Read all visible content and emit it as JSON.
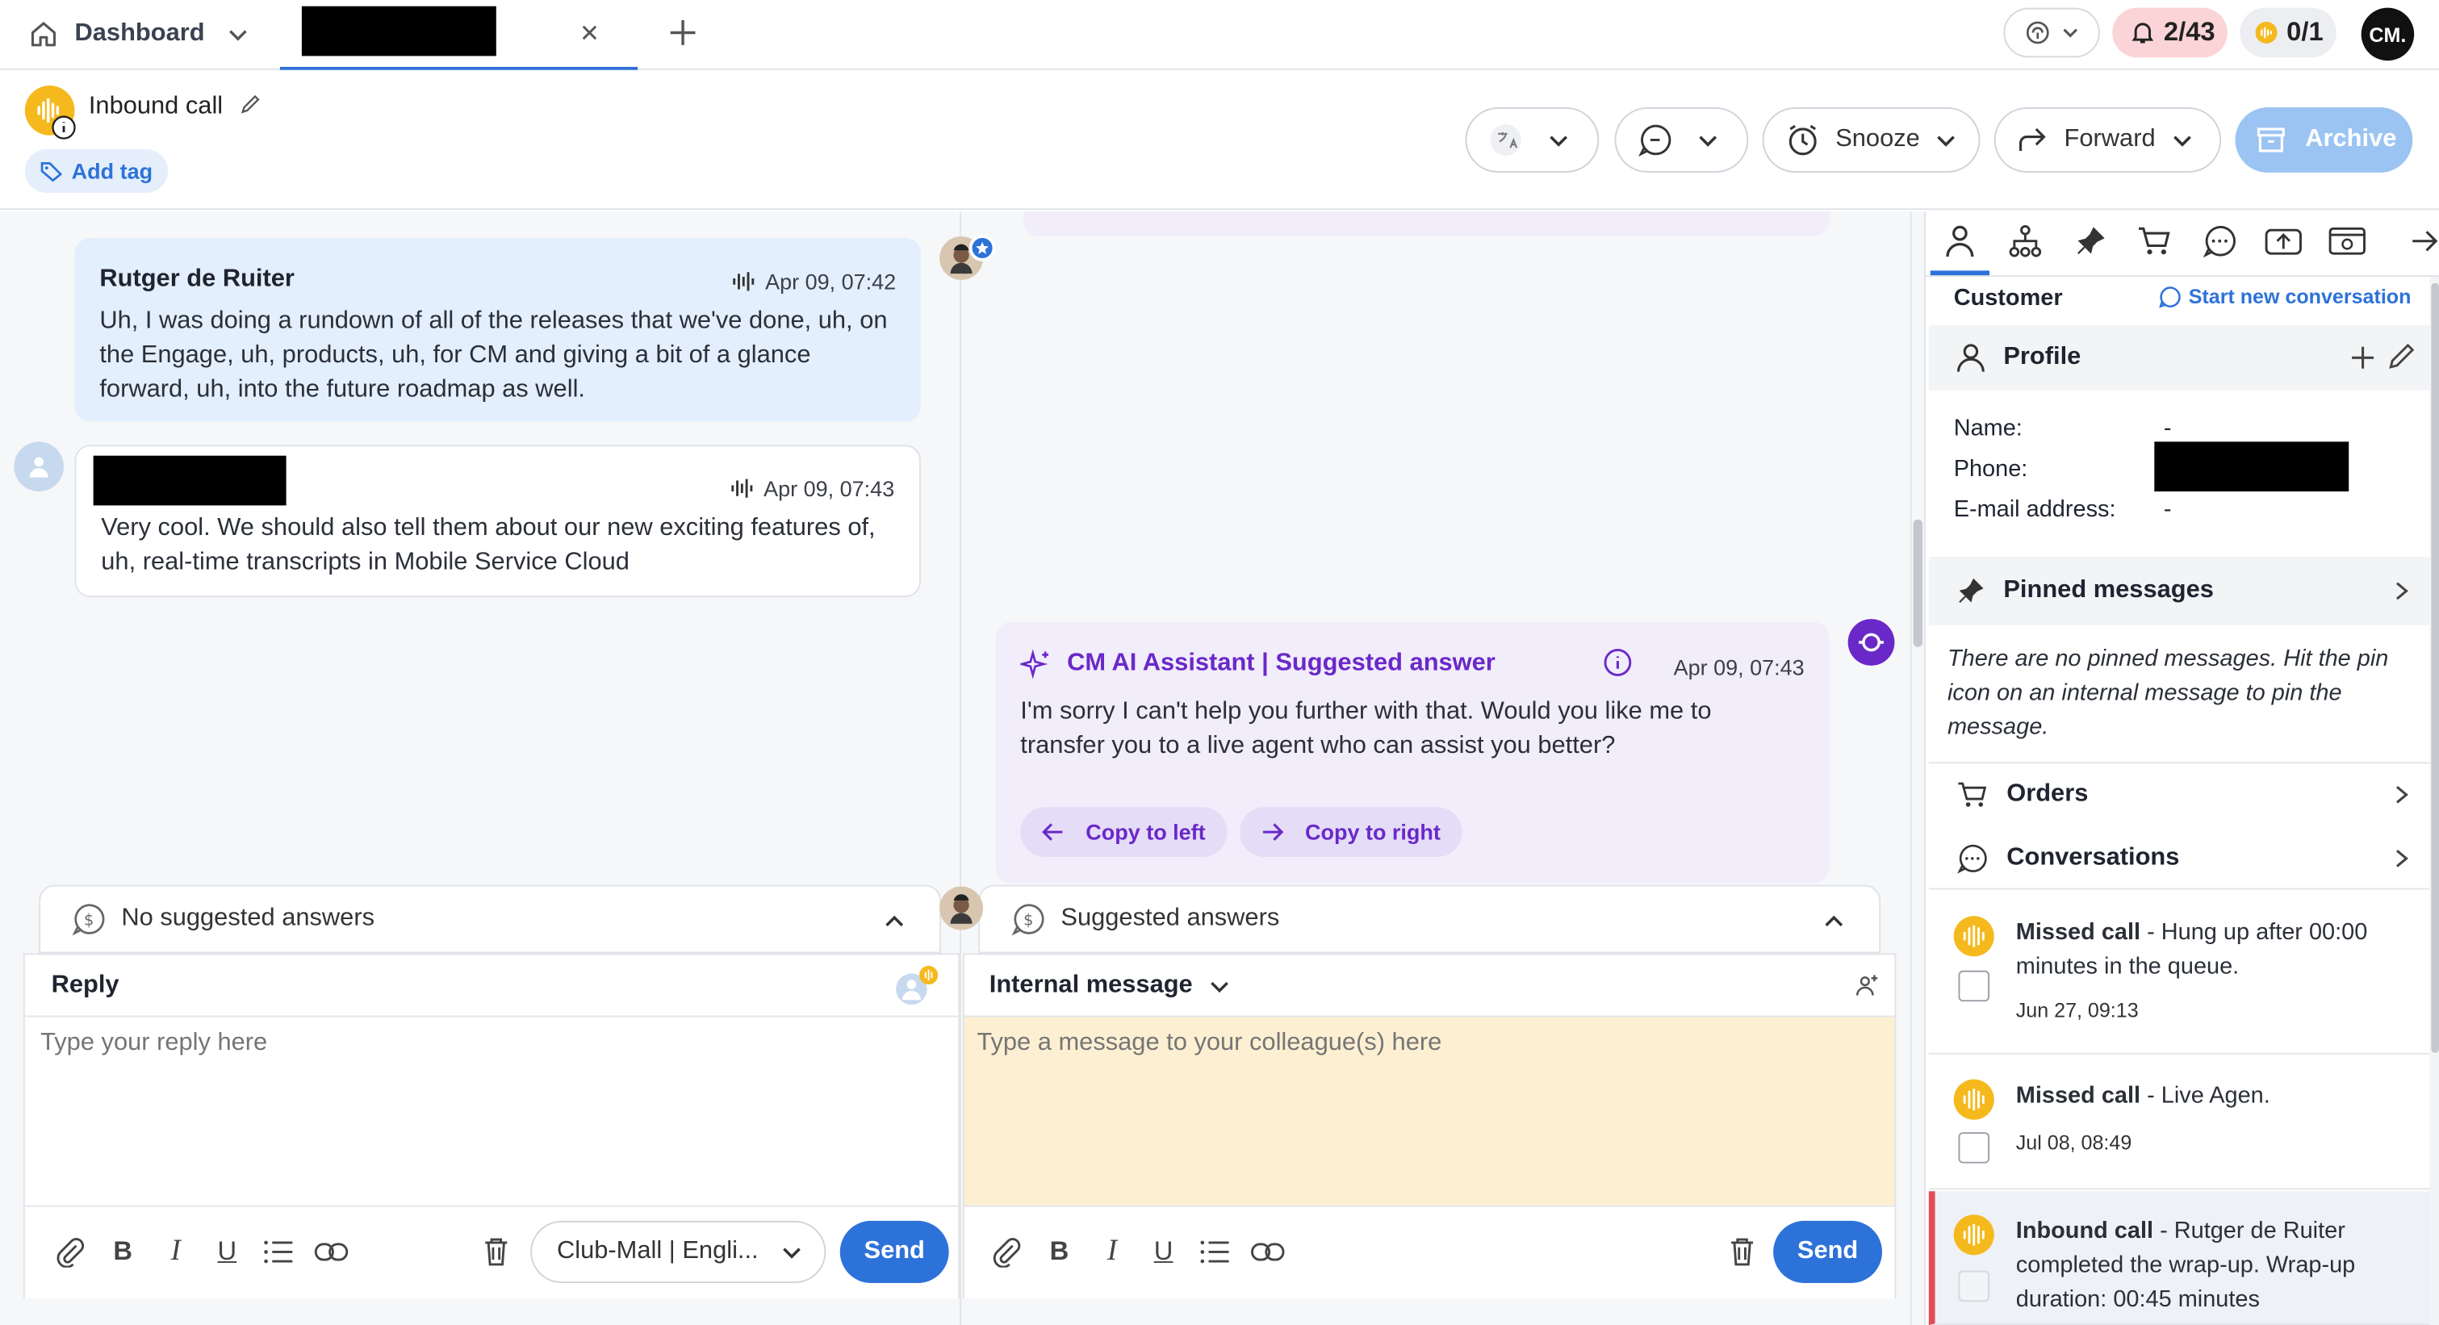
{
  "topbar": {
    "dashboard_label": "Dashboard",
    "notifications_count": "2/43",
    "calls_count": "0/1",
    "avatar_initials": "CM."
  },
  "conversation": {
    "title": "Inbound call",
    "add_tag_label": "Add tag",
    "snooze_label": "Snooze",
    "forward_label": "Forward",
    "archive_label": "Archive"
  },
  "messages": [
    {
      "author": "Rutger de Ruiter",
      "time": "Apr 09, 07:42",
      "text": "Uh, I was doing a rundown of all of the releases that we've done, uh, on the Engage, uh, products, uh, for CM and giving a bit of a glance forward, uh, into the future roadmap as well."
    },
    {
      "author": "",
      "time": "Apr 09, 07:43",
      "text": "Very cool. We should also tell them about our new exciting features of, uh, real-time transcripts in Mobile Service Cloud"
    }
  ],
  "ai_suggestion": {
    "title": "CM AI Assistant | Suggested answer",
    "time": "Apr 09, 07:43",
    "text": "I'm sorry I can't help you further with that. Would you like me to transfer you to a live agent who can assist you better?",
    "copy_left_label": "Copy to left",
    "copy_right_label": "Copy to right"
  },
  "reply": {
    "suggestions_label": "No suggested answers",
    "header_label": "Reply",
    "placeholder": "Type your reply here",
    "channel_select": "Club-Mall | Engli...",
    "send_label": "Send"
  },
  "internal": {
    "suggestions_label": "Suggested answers",
    "header_label": "Internal message",
    "placeholder": "Type a message to your colleague(s) here",
    "send_label": "Send"
  },
  "sidebar": {
    "section_title": "Customer",
    "start_new_label": "Start new conversation",
    "profile_label": "Profile",
    "fields": [
      {
        "label": "Name:",
        "value": "-"
      },
      {
        "label": "Phone:",
        "value": ""
      },
      {
        "label": "E-mail address:",
        "value": "-"
      }
    ],
    "pinned_label": "Pinned messages",
    "pinned_empty": "There are no pinned messages. Hit the pin icon on an internal message to pin the message.",
    "orders_label": "Orders",
    "conversations_label": "Conversations",
    "conversations": [
      {
        "type": "Missed call",
        "detail": " - Hung up after 00:00 minutes in the queue.",
        "date": "Jun 27, 09:13"
      },
      {
        "type": "Missed call",
        "detail": " - Live Agen.",
        "date": "Jul 08, 08:49"
      },
      {
        "type": "Inbound call",
        "detail": " - Rutger de Ruiter completed the wrap-up. Wrap-up duration: 00:45 minutes",
        "date": ""
      }
    ]
  },
  "colors": {
    "primary": "#2d72d9",
    "ai_purple": "#6a28c9",
    "call_yellow": "#f5b91e",
    "internal_bg": "#fdefd2",
    "customer_bubble": "#e3effc"
  }
}
